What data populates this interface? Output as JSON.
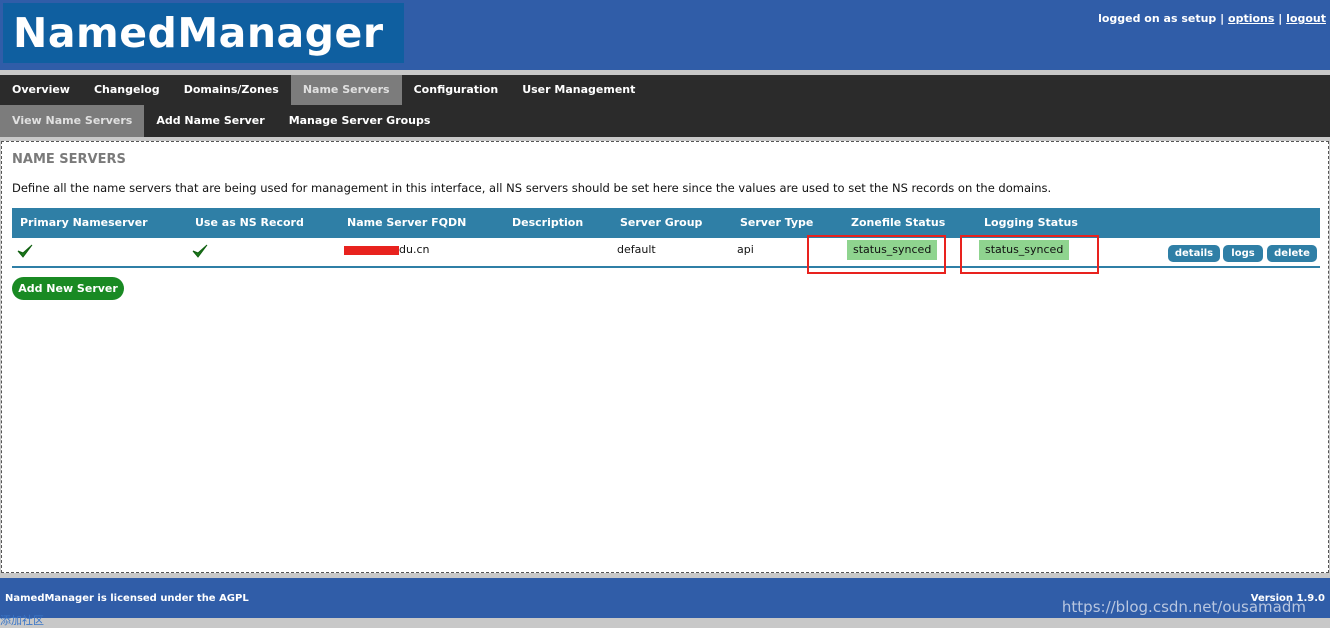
{
  "app": {
    "logo": "NamedManager",
    "user_prefix": "logged on as setup",
    "sep": "|",
    "options_link": "options",
    "logout_link": "logout"
  },
  "nav": {
    "primary": [
      "Overview",
      "Changelog",
      "Domains/Zones",
      "Name Servers",
      "Configuration",
      "User Management"
    ],
    "primary_active": 3,
    "secondary": [
      "View Name Servers",
      "Add Name Server",
      "Manage Server Groups"
    ],
    "secondary_active": 0
  },
  "page": {
    "title": "NAME SERVERS",
    "description": "Define all the name servers that are being used for management in this interface, all NS servers should be set here since the values are used to set the NS records on the domains."
  },
  "table": {
    "headers": [
      "Primary Nameserver",
      "Use as NS Record",
      "Name Server FQDN",
      "Description",
      "Server Group",
      "Server Type",
      "Zonefile Status",
      "Logging Status"
    ],
    "rows": [
      {
        "primary": "check-icon",
        "use_ns": "check-icon",
        "fqdn": "du.cn",
        "description": "",
        "group": "default",
        "type": "api",
        "zonefile_status": "status_synced",
        "logging_status": "status_synced",
        "actions": [
          "details",
          "logs",
          "delete"
        ]
      }
    ]
  },
  "add_button": "Add New Server",
  "footer": {
    "license": "NamedManager is licensed under the AGPL",
    "version": "Version 1.9.0"
  },
  "watermark": "https://blog.csdn.net/ousamadm",
  "corner_link": "添加社区",
  "colors": {
    "header_bg": "#305da8",
    "logo_bg": "#0f5fa0",
    "nav_bg": "#2b2b2b",
    "table_header": "#2f7fa6",
    "status_synced": "#8fd48f",
    "add_button": "#198a23",
    "highlight": "#e8221e"
  }
}
